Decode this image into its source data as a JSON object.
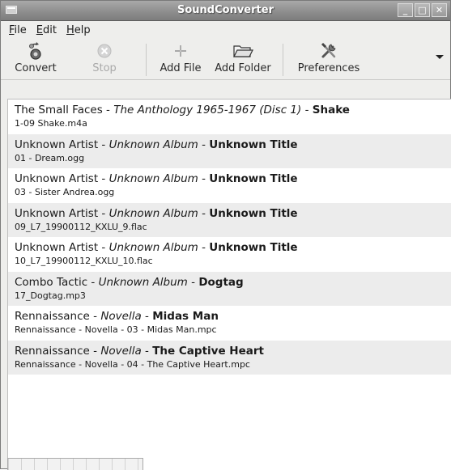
{
  "window": {
    "title": "SoundConverter"
  },
  "menubar": {
    "items": [
      {
        "pre": "",
        "mnemonic": "F",
        "post": "ile"
      },
      {
        "pre": "",
        "mnemonic": "E",
        "post": "dit"
      },
      {
        "pre": "",
        "mnemonic": "H",
        "post": "elp"
      }
    ]
  },
  "toolbar": {
    "convert_label": "Convert",
    "stop_label": "Stop",
    "add_file_label": "Add File",
    "add_folder_label": "Add Folder",
    "preferences_label": "Preferences"
  },
  "files": [
    {
      "artist": "The Small Faces",
      "album": "The Anthology 1965-1967 (Disc 1)",
      "title": "Shake",
      "filename": "1-09 Shake.m4a"
    },
    {
      "artist": "Unknown Artist",
      "album": "Unknown Album",
      "title": "Unknown Title",
      "filename": "01 - Dream.ogg"
    },
    {
      "artist": "Unknown Artist",
      "album": "Unknown Album",
      "title": "Unknown Title",
      "filename": "03 - Sister Andrea.ogg"
    },
    {
      "artist": "Unknown Artist",
      "album": "Unknown Album",
      "title": "Unknown Title",
      "filename": "09_L7_19900112_KXLU_9.flac"
    },
    {
      "artist": "Unknown Artist",
      "album": "Unknown Album",
      "title": "Unknown Title",
      "filename": "10_L7_19900112_KXLU_10.flac"
    },
    {
      "artist": "Combo Tactic",
      "album": "Unknown Album",
      "title": "Dogtag",
      "filename": "17_Dogtag.mp3"
    },
    {
      "artist": "Rennaissance",
      "album": "Novella",
      "title": "Midas Man",
      "filename": "Rennaissance - Novella - 03 - Midas Man.mpc"
    },
    {
      "artist": "Rennaissance",
      "album": "Novella",
      "title": "The Captive Heart",
      "filename": "Rennaissance - Novella - 04 - The Captive Heart.mpc"
    }
  ]
}
